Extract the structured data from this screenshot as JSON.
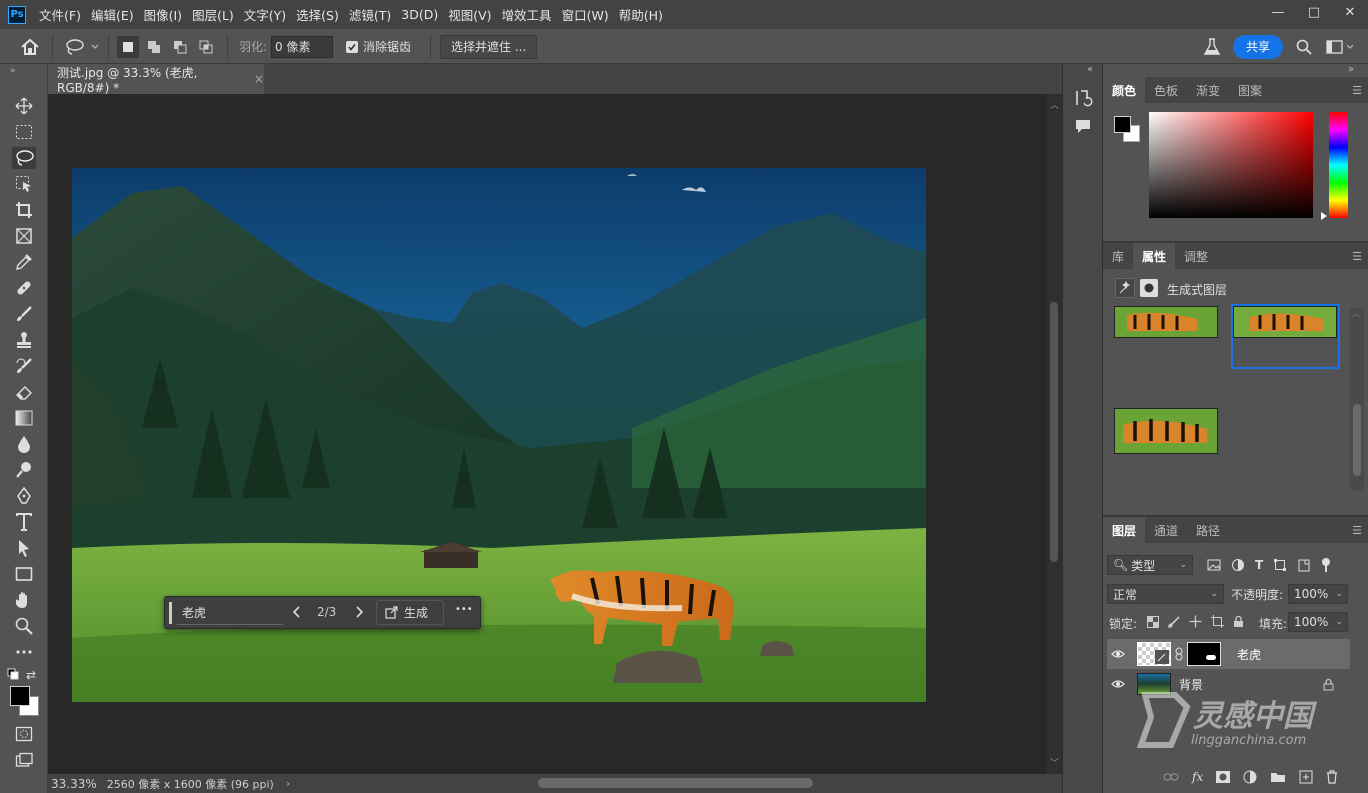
{
  "menubar": {
    "logo": "Ps",
    "items": [
      "文件(F)",
      "编辑(E)",
      "图像(I)",
      "图层(L)",
      "文字(Y)",
      "选择(S)",
      "滤镜(T)",
      "3D(D)",
      "视图(V)",
      "增效工具",
      "窗口(W)",
      "帮助(H)"
    ]
  },
  "window": {
    "minimize": "—",
    "maximize": "□",
    "close": "✕"
  },
  "options": {
    "feather_label": "羽化:",
    "feather_value": "0 像素",
    "antialias_label": "消除锯齿",
    "antialias_checked": true,
    "select_mask_label": "选择并遮住 ...",
    "share_label": "共享"
  },
  "document": {
    "tab_title": "测试.jpg @ 33.3% (老虎, RGB/8#) *",
    "close": "×"
  },
  "generative_bar": {
    "prompt": "老虎",
    "variation": "2/3",
    "generate_label": "生成",
    "more": "•••"
  },
  "status": {
    "zoom": "33.33%",
    "info": "2560 像素 x 1600 像素 (96 ppi)",
    "arrow": "›"
  },
  "color_panel": {
    "tabs": [
      "颜色",
      "色板",
      "渐变",
      "图案"
    ],
    "active": 0,
    "foreground": "#000000",
    "background": "#ffffff",
    "hue": "#ff0000"
  },
  "properties_panel": {
    "tabs": [
      "库",
      "属性",
      "调整"
    ],
    "active": 1,
    "layer_type": "生成式图层",
    "selected_variation": 2
  },
  "layers_panel": {
    "tabs": [
      "图层",
      "通道",
      "路径"
    ],
    "active": 0,
    "filter_kind": "类型",
    "blend_mode": "正常",
    "opacity_label": "不透明度:",
    "opacity": "100%",
    "lock_label": "锁定:",
    "fill_label": "填充:",
    "fill": "100%",
    "layers": [
      {
        "name": "老虎",
        "selected": true,
        "visible": true
      },
      {
        "name": "背景",
        "selected": false,
        "visible": true,
        "locked": true
      }
    ]
  },
  "watermark": {
    "brand": "灵感中国",
    "url": "lingganchina.com"
  },
  "colors": {
    "accent": "#1473e6",
    "selection": "#1473e6",
    "panel": "#535353",
    "canvas": "#282828"
  }
}
